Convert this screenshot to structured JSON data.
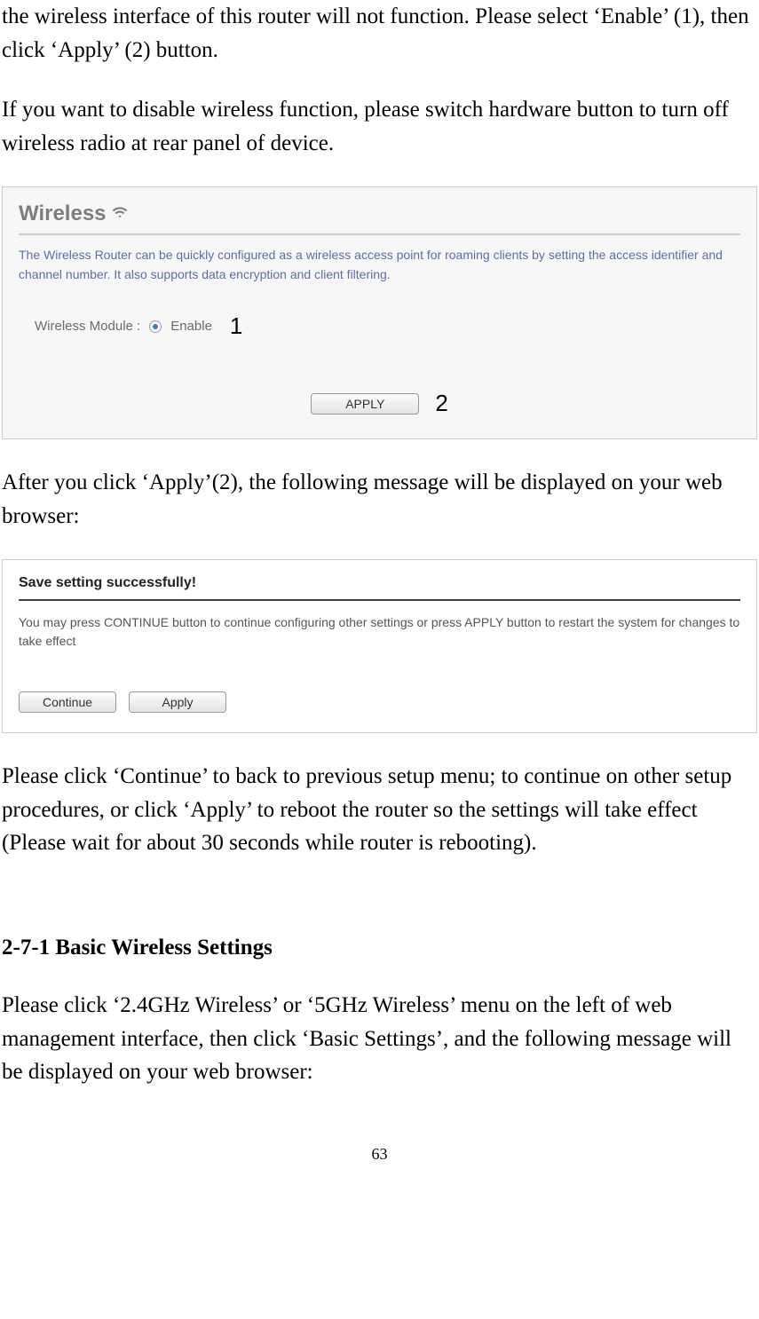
{
  "body": {
    "p1": "the wireless interface of this router will not function. Please select ‘Enable’ (1), then click ‘Apply’ (2) button.",
    "p2": "If you want to disable wireless function, please switch hardware button to turn off wireless radio at rear panel of device.",
    "p3": "After you click ‘Apply’(2), the following message will be displayed on your web browser:",
    "p4": "Please click ‘Continue’ to back to previous setup menu; to continue on other setup procedures, or click ‘Apply’ to reboot the router so the settings will take effect (Please wait for about 30 seconds while router is rebooting).",
    "heading": "2-7-1 Basic Wireless Settings",
    "p5": "Please click ‘2.4GHz Wireless’ or ‘5GHz Wireless’ menu on the left of web management interface, then click ‘Basic Settings’, and the following message will be displayed on your web browser:"
  },
  "wireless_panel": {
    "title": "Wireless",
    "description": "The Wireless Router can be quickly configured as a wireless access point for roaming clients by setting the access identifier and channel number. It also supports data encryption and client filtering.",
    "module_label": "Wireless Module :",
    "enable_label": "Enable",
    "annot1": "1",
    "apply_label": "APPLY",
    "annot2": "2"
  },
  "save_panel": {
    "title": "Save setting successfully!",
    "description": "You may press CONTINUE button to continue configuring other settings or press APPLY button to restart the system for changes to take effect",
    "continue_label": "Continue",
    "apply_label": "Apply"
  },
  "page_number": "63"
}
